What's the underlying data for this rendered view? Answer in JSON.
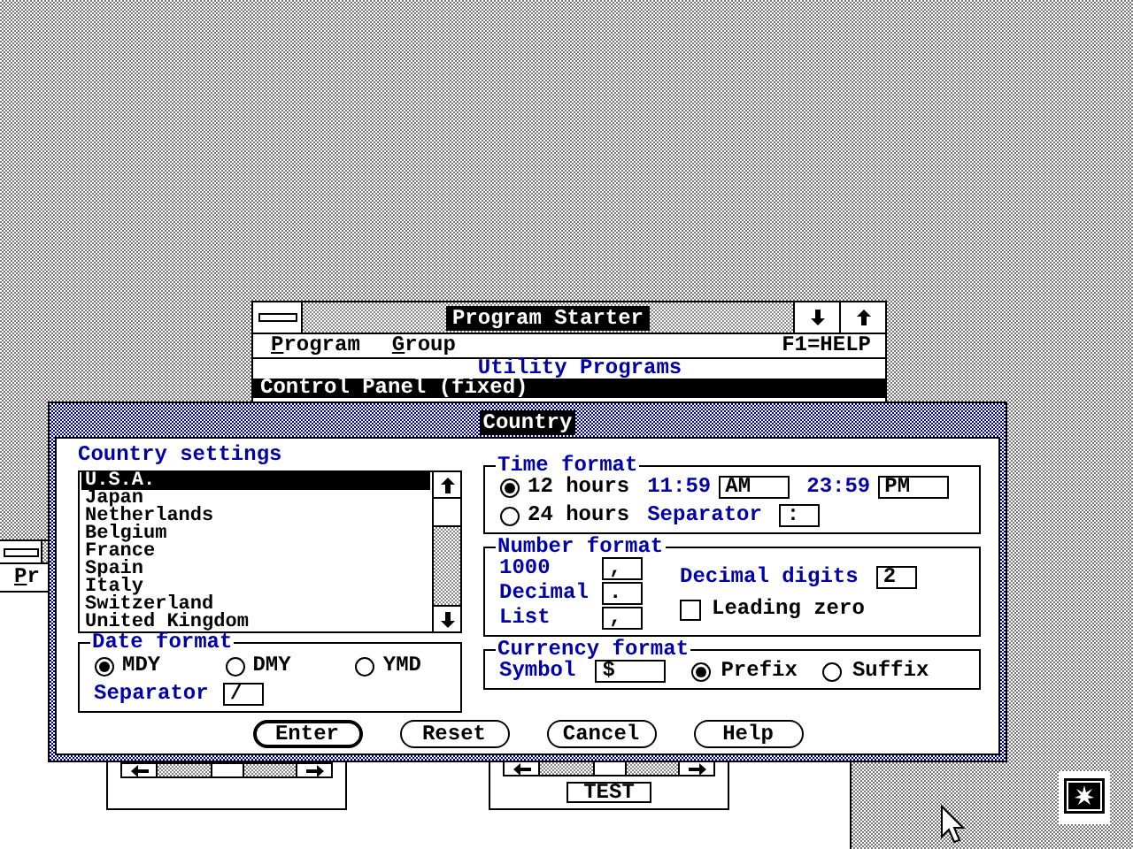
{
  "program_starter": {
    "title": "Program Starter",
    "menu": [
      {
        "label": "Program"
      },
      {
        "label": "Group"
      }
    ],
    "help": "F1=HELP",
    "group_title": "Utility Programs",
    "items": [
      {
        "label": "Control Panel (fixed)",
        "selected": true
      }
    ]
  },
  "background_window": {
    "menu": [
      {
        "label": "Pr"
      }
    ],
    "button": "TEST"
  },
  "dialog": {
    "title": "Country",
    "heading": "Country settings",
    "countries": [
      {
        "label": "U.S.A.",
        "selected": true
      },
      {
        "label": "Japan",
        "selected": false
      },
      {
        "label": "Netherlands",
        "selected": false
      },
      {
        "label": "Belgium",
        "selected": false
      },
      {
        "label": "France",
        "selected": false
      },
      {
        "label": "Spain",
        "selected": false
      },
      {
        "label": "Italy",
        "selected": false
      },
      {
        "label": "Switzerland",
        "selected": false
      },
      {
        "label": "United Kingdom",
        "selected": false
      }
    ],
    "date_format": {
      "title": "Date format",
      "options": [
        {
          "label": "MDY",
          "selected": true
        },
        {
          "label": "DMY",
          "selected": false
        },
        {
          "label": "YMD",
          "selected": false
        }
      ],
      "separator_label": "Separator",
      "separator": "/"
    },
    "time_format": {
      "title": "Time format",
      "options": [
        {
          "label": "12 hours",
          "selected": true
        },
        {
          "label": "24 hours",
          "selected": false
        }
      ],
      "am_time": "11:59",
      "am": "AM",
      "pm_time": "23:59",
      "pm": "PM",
      "separator_label": "Separator",
      "separator": ":"
    },
    "number_format": {
      "title": "Number format",
      "thousands_label": "1000",
      "thousands": ",",
      "decimal_label": "Decimal",
      "decimal": ".",
      "list_label": "List",
      "list": ",",
      "digits_label": "Decimal digits",
      "digits": "2",
      "leading_zero": {
        "label": "Leading zero",
        "checked": false
      }
    },
    "currency_format": {
      "title": "Currency format",
      "symbol_label": "Symbol",
      "symbol": "$",
      "placement": [
        {
          "label": "Prefix",
          "selected": true
        },
        {
          "label": "Suffix",
          "selected": false
        }
      ]
    },
    "buttons": [
      {
        "label": "Enter",
        "default": true
      },
      {
        "label": "Reset",
        "default": false
      },
      {
        "label": "Cancel",
        "default": false
      },
      {
        "label": "Help",
        "default": false
      }
    ]
  }
}
